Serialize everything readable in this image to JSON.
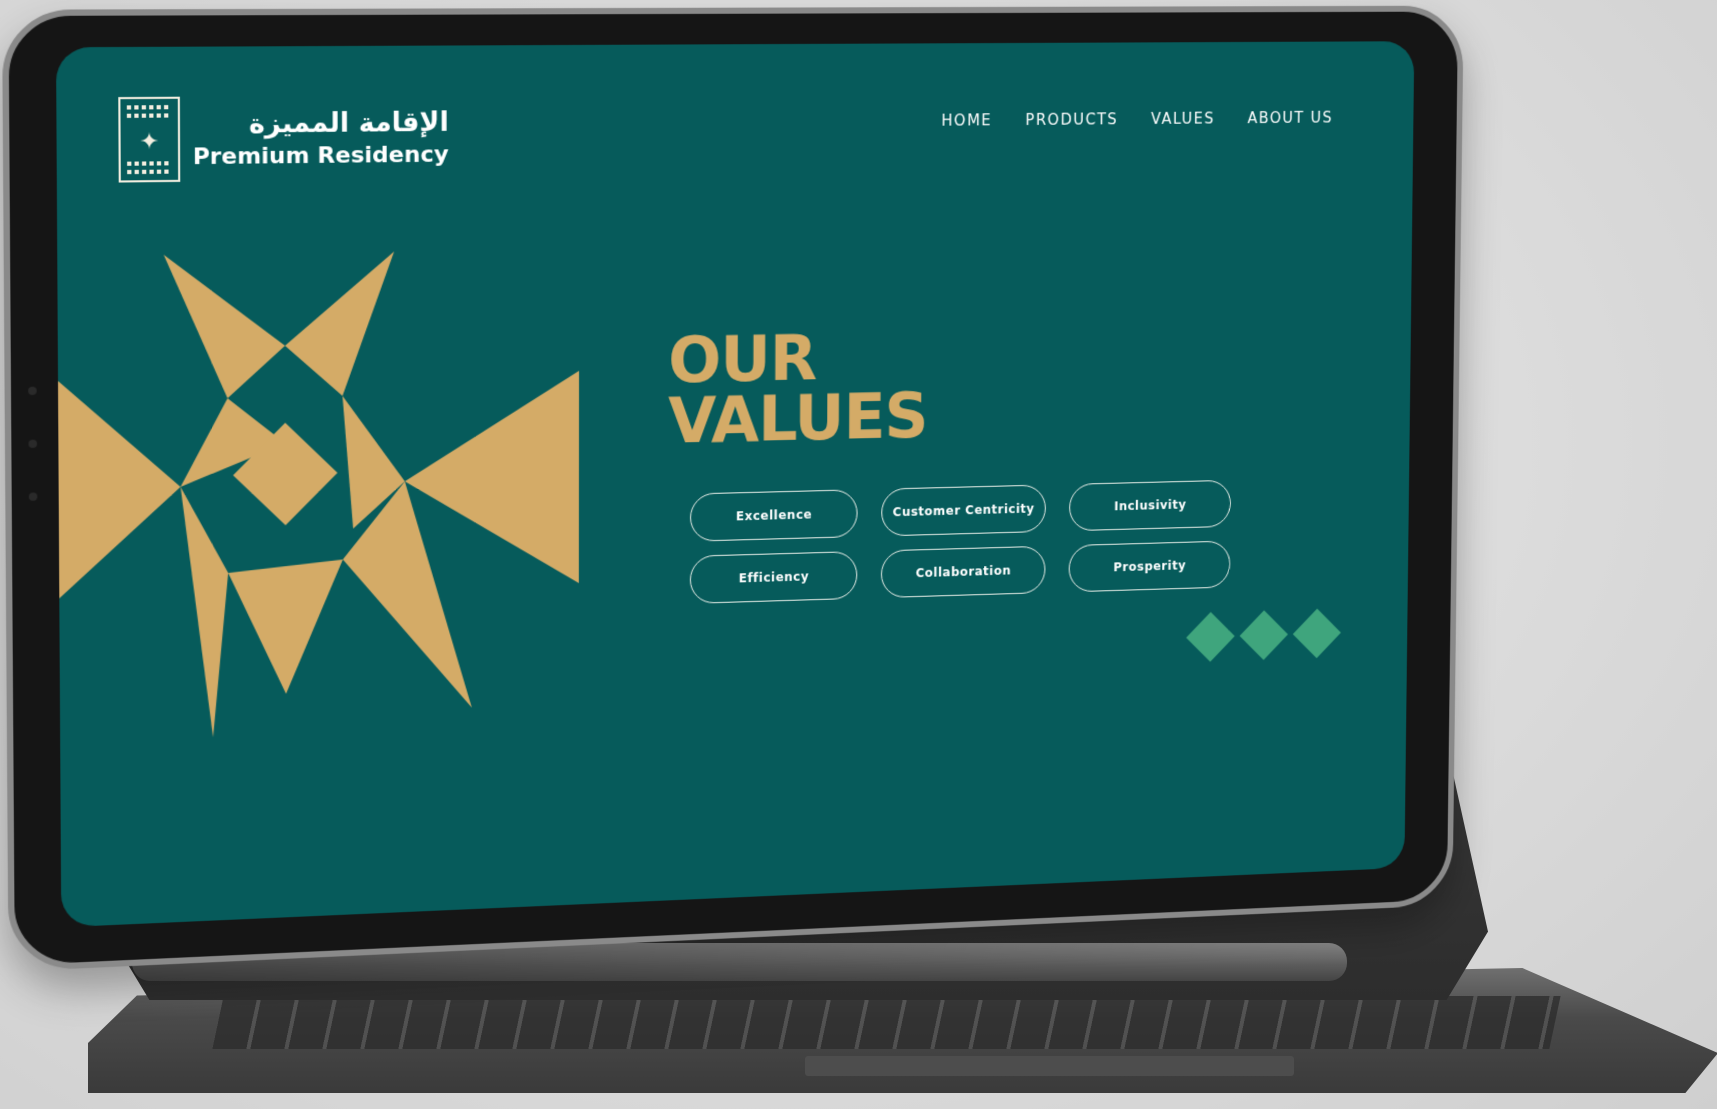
{
  "brand": {
    "name_ar": "الإقامة المميزة",
    "name_en": "Premium Residency"
  },
  "nav": {
    "items": [
      "HOME",
      "PRODUCTS",
      "VALUES",
      "ABOUT US"
    ]
  },
  "hero": {
    "heading_line1": "OUR",
    "heading_line2": "VALUES"
  },
  "values": {
    "items": [
      "Excellence",
      "Customer Centricity",
      "Inclusivity",
      "Efficiency",
      "Collaboration",
      "Prosperity"
    ]
  },
  "colors": {
    "background": "#065b5b",
    "accent_gold": "#d4ab67",
    "accent_green": "#3fa57d",
    "text": "#ffffff"
  },
  "icons": {
    "logo": "saudi-emblem-icon",
    "decorations": [
      "geometric-pattern-icon",
      "diamond-row-icon"
    ]
  }
}
